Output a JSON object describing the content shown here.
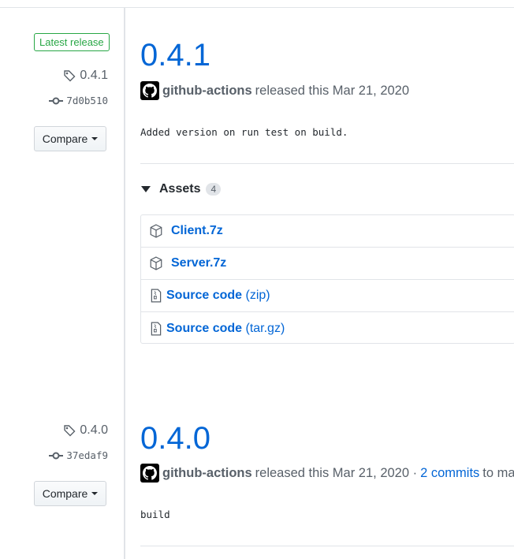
{
  "releases": [
    {
      "badge": "Latest release",
      "tag": "0.4.1",
      "commit": "7d0b510",
      "compare_label": "Compare",
      "title": "0.4.1",
      "author": "github-actions",
      "released_text": "released this Mar 21, 2020",
      "notes": "Added version on run test on build.",
      "assets_label": "Assets",
      "assets_count": "4",
      "assets": [
        {
          "name": "Client.7z",
          "icon": "package-icon"
        },
        {
          "name": "Server.7z",
          "icon": "package-icon"
        },
        {
          "name": "Source code",
          "ext": "(zip)",
          "icon": "file-zip-icon"
        },
        {
          "name": "Source code",
          "ext": "(tar.gz)",
          "icon": "file-zip-icon"
        }
      ]
    },
    {
      "tag": "0.4.0",
      "commit": "37edaf9",
      "compare_label": "Compare",
      "title": "0.4.0",
      "author": "github-actions",
      "released_text": "released this Mar 21, 2020 ·",
      "commits_link": "2 commits",
      "after_link": "to ma",
      "notes": "build"
    }
  ],
  "colors": {
    "link": "#0366d6",
    "latest_badge": "#28a745",
    "muted": "#586069"
  }
}
